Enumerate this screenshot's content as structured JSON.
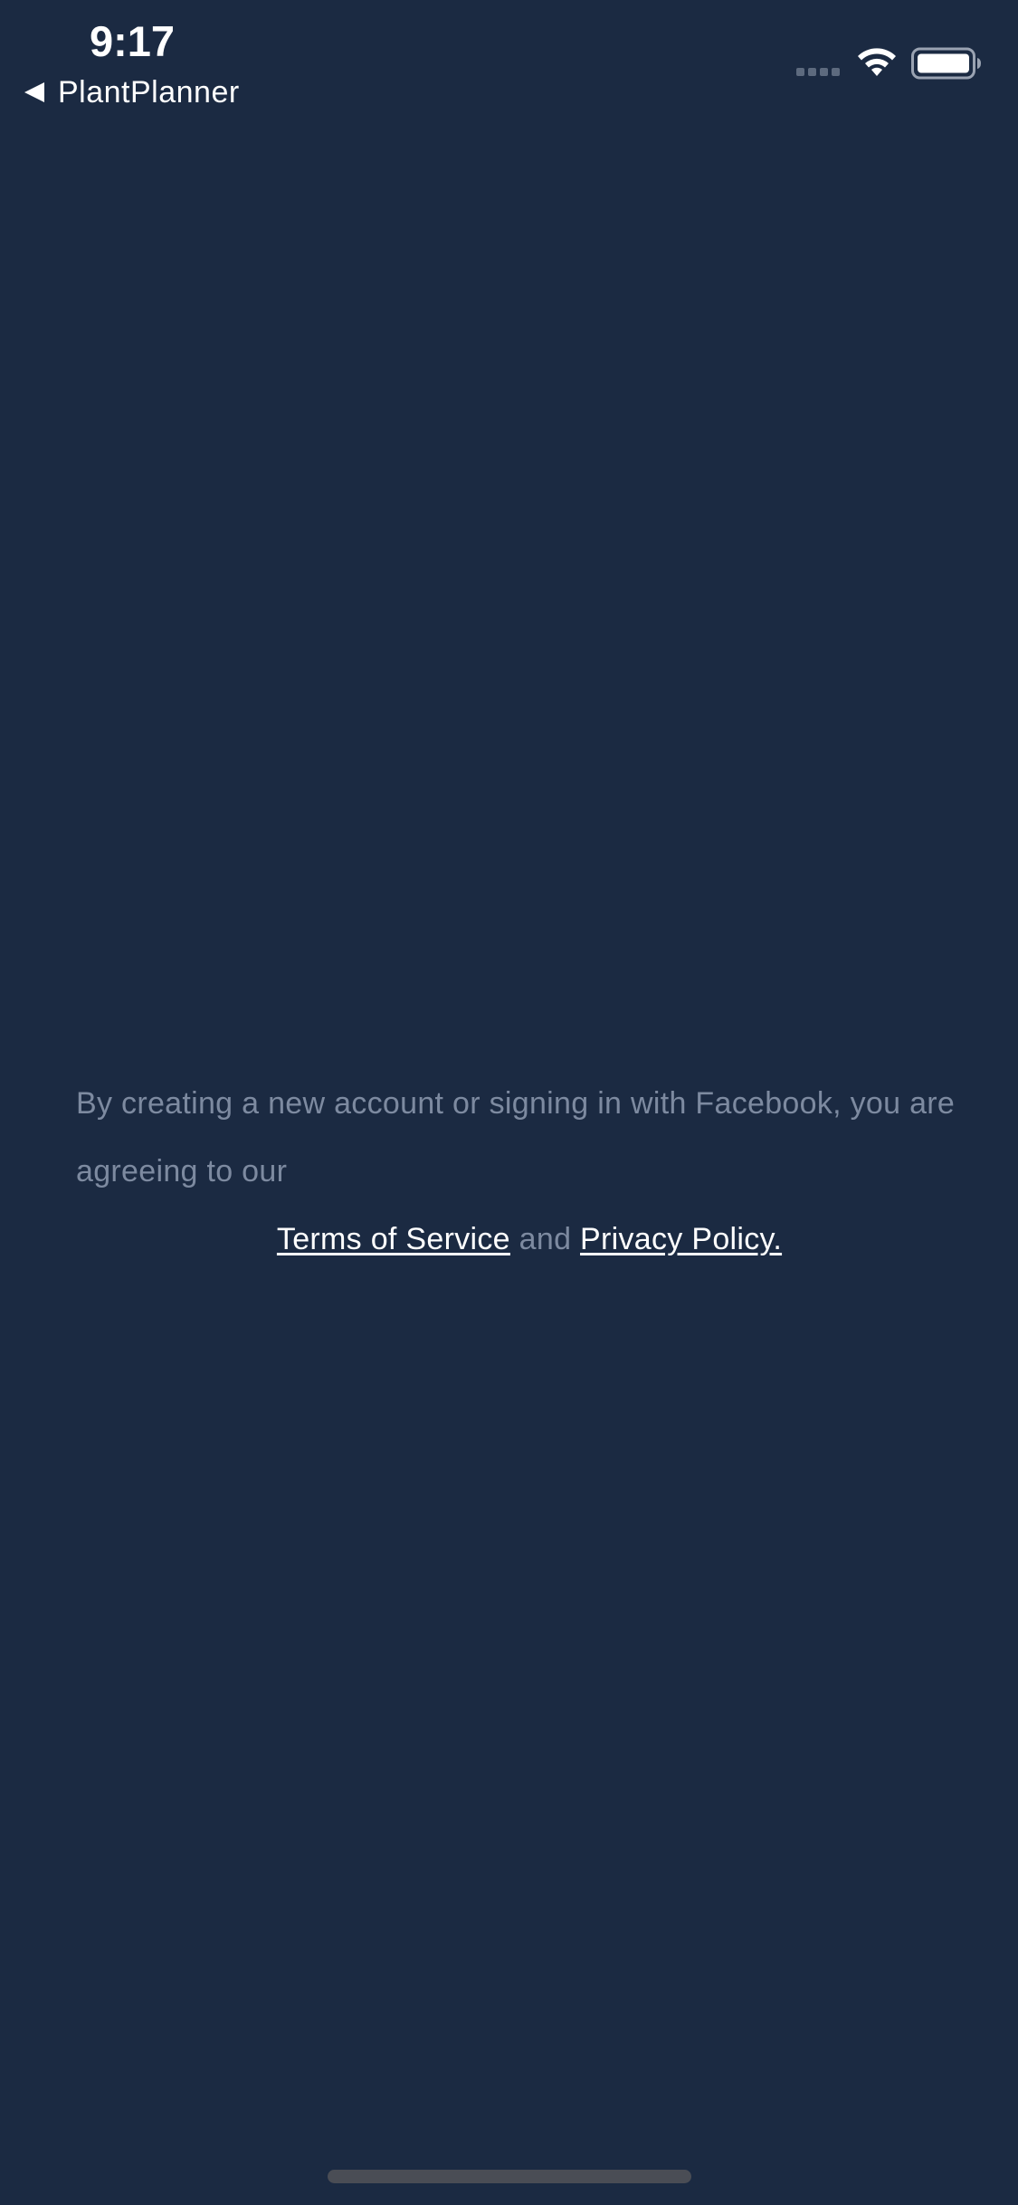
{
  "status_bar": {
    "time": "9:17",
    "back_label": "PlantPlanner",
    "icons": [
      "signal-icon",
      "wifi-icon",
      "battery-icon"
    ]
  },
  "legal": {
    "intro_text": "By creating a new account or signing in with Facebook, you are agreeing to our",
    "terms_label": "Terms of Service",
    "connector": "and",
    "privacy_label": "Privacy Policy."
  },
  "colors": {
    "background": "#1b2a42",
    "muted_text": "#7d8aa0",
    "link_text": "#ffffff"
  }
}
